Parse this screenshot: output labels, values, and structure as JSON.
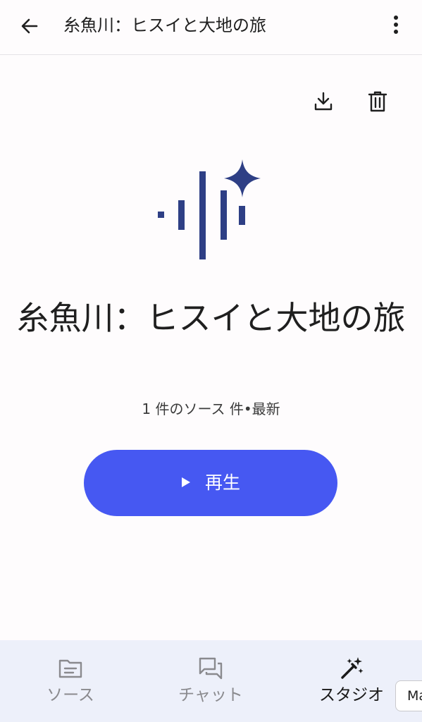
{
  "header": {
    "title": "糸魚川：ヒスイと大地の旅",
    "back_icon": "arrow-back-icon",
    "more_icon": "more-vert-icon"
  },
  "actions": {
    "download_icon": "download-icon",
    "delete_icon": "trash-icon"
  },
  "artwork": {
    "icon": "audio-waveform-sparkle-icon",
    "color": "#2e3f85"
  },
  "main": {
    "title": "糸魚川：ヒスイと大地の旅",
    "subtitle": "1 件のソース 件•最新"
  },
  "play_button": {
    "label": "再生",
    "icon": "play-icon",
    "color": "#4658f2"
  },
  "bottom_nav": {
    "items": [
      {
        "label": "ソース",
        "icon": "folder-notes-icon",
        "active": false
      },
      {
        "label": "チャット",
        "icon": "chat-bubbles-icon",
        "active": false
      },
      {
        "label": "スタジオ",
        "icon": "magic-wand-icon",
        "active": true
      }
    ]
  },
  "chip": {
    "label": "Ma"
  },
  "colors": {
    "background": "#fefcfd",
    "nav_background": "#edf0fa",
    "accent": "#4658f2"
  }
}
